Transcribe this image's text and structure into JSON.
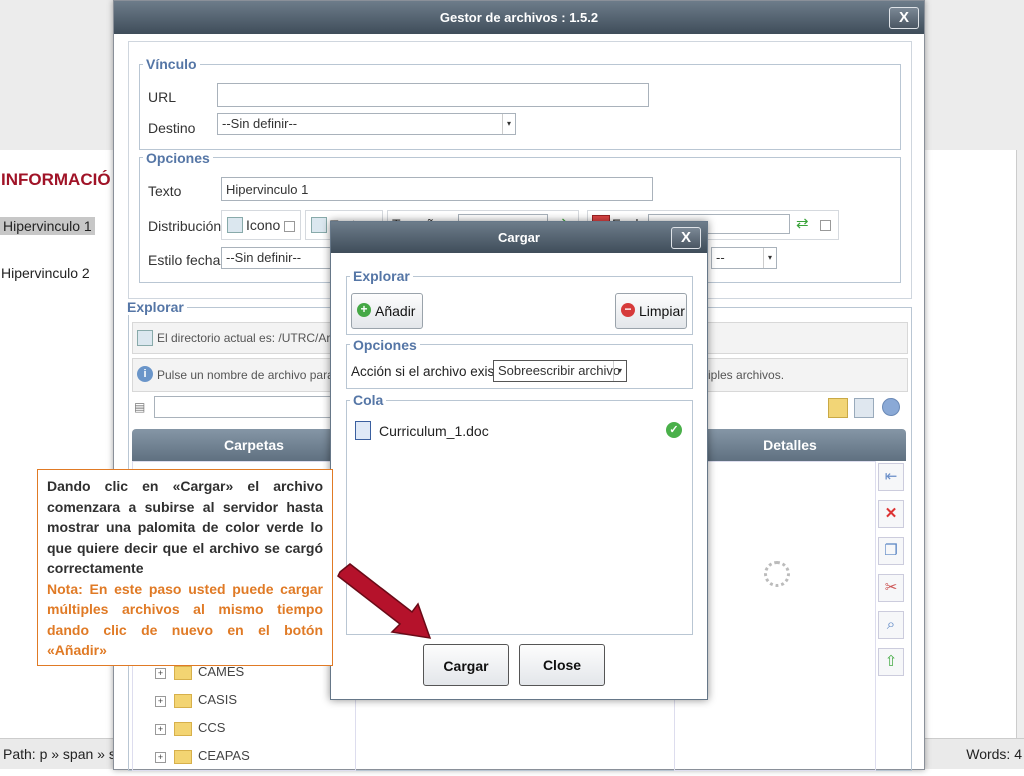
{
  "background": {
    "section_title": "INFORMACIÓ",
    "link1": "Hipervinculo 1",
    "link2": "Hipervinculo 2",
    "status_path": "Path: p » span » sp",
    "status_words": "Words: 4"
  },
  "file_manager": {
    "title": "Gestor de archivos : 1.5.2",
    "close_label": "X",
    "vinculo": {
      "legend": "Vínculo",
      "url_label": "URL",
      "url_value": "",
      "destino_label": "Destino",
      "destino_value": "--Sin definir--"
    },
    "opciones": {
      "legend": "Opciones",
      "texto_label": "Texto",
      "texto_value": "Hipervinculo 1",
      "distribucion_label": "Distribución",
      "icono_label": "Icono",
      "texto_option_label": "Texto",
      "tamano_label": "Tamaño",
      "fecha_label": "Fecha",
      "estilo_fecha_label": "Estilo fecha",
      "estilo_fecha_value": "--Sin definir--",
      "right_select_value": "--"
    },
    "explorar": {
      "legend": "Explorar",
      "current_dir": "El directorio actual es: /UTRC/Archi",
      "info_text_left": "Pulse un nombre de archivo para ins",
      "info_text_right": "iples archivos.",
      "folders_header": "Carpetas",
      "details_header": "Detalles",
      "folders": [
        "CAMES",
        "CASIS",
        "CCS",
        "CEAPAS"
      ]
    }
  },
  "upload_dialog": {
    "title": "Cargar",
    "close_label": "X",
    "explorar_legend": "Explorar",
    "add_button": "Añadir",
    "clear_button": "Limpiar",
    "opciones_legend": "Opciones",
    "exists_label": "Acción si el archivo existe:",
    "exists_value": "Sobreescribir archivo",
    "cola_legend": "Cola",
    "queue": [
      {
        "file": "Curriculum_1.doc",
        "status": "uploaded"
      }
    ],
    "upload_button": "Cargar",
    "close_button": "Close"
  },
  "annotation": {
    "main_text": "Dando clic en «Cargar» el archivo comenzara a subirse al servidor hasta mostrar una palomita de color verde lo que quiere decir que el archivo se cargó correctamente",
    "note_text": "Nota: En este paso usted puede cargar múltiples archivos al mismo tiempo dando clic de nuevo en el botón «Añadir»"
  },
  "colors": {
    "title_bar": "#4f5d6a",
    "legend_blue": "#5576a6",
    "note_orange": "#e07a25",
    "arrow_red": "#b5122b",
    "check_green": "#4ab04a"
  }
}
